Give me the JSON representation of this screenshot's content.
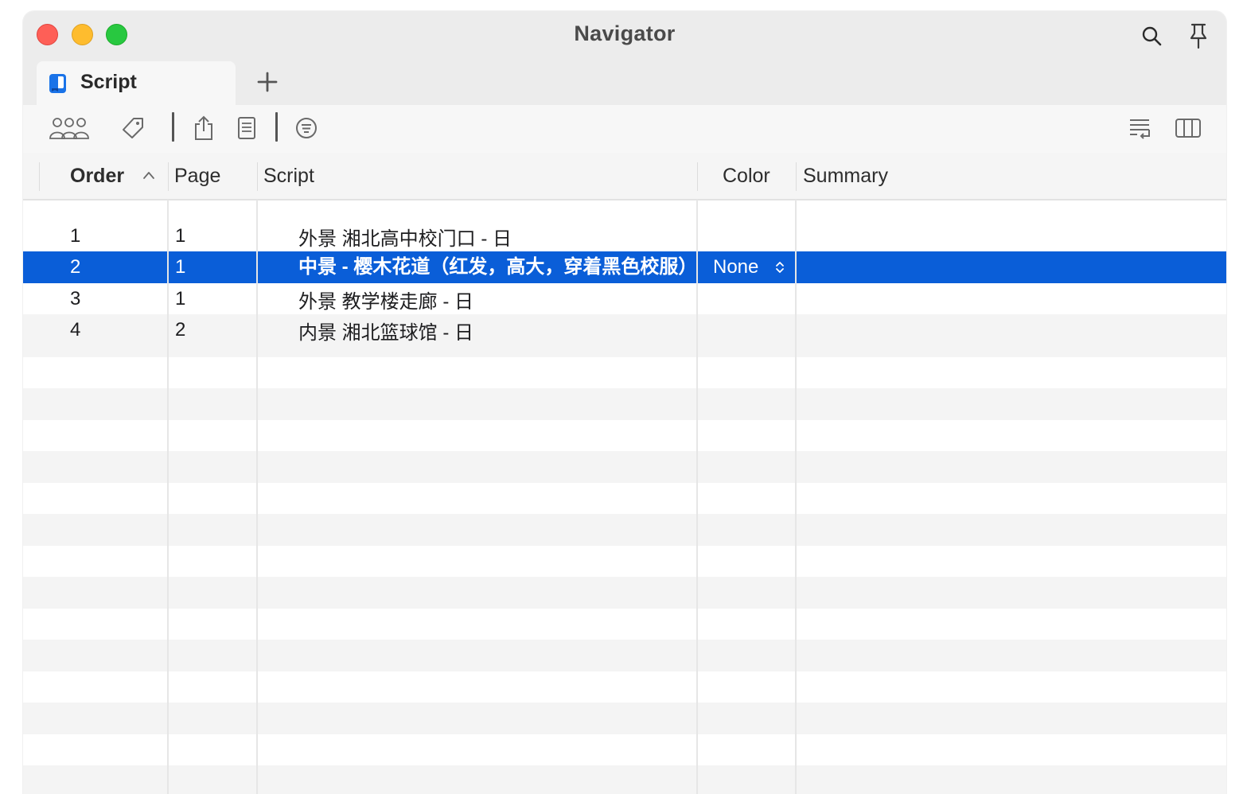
{
  "window": {
    "title": "Navigator"
  },
  "tabs": [
    {
      "label": "Script",
      "icon": "script-book-icon"
    }
  ],
  "toolbar": {
    "left_icons": [
      "characters-icon",
      "tag-icon",
      "share-icon",
      "notes-icon",
      "filter-icon"
    ],
    "right_icons": [
      "wrap-text-icon",
      "columns-icon"
    ]
  },
  "table": {
    "columns": [
      "Order",
      "Page",
      "Script",
      "Color",
      "Summary"
    ],
    "sort_column": "Order",
    "sort_direction": "ascending",
    "rows": [
      {
        "order": "1",
        "page": "1",
        "script": "外景  湘北高中校门口  -  日",
        "color": "",
        "summary": ""
      },
      {
        "order": "2",
        "page": "1",
        "script": "中景  -  樱木花道（红发，高大，穿着黑色校服）",
        "color": "None",
        "summary": ""
      },
      {
        "order": "3",
        "page": "1",
        "script": "外景  教学楼走廊  -  日",
        "color": "",
        "summary": ""
      },
      {
        "order": "4",
        "page": "2",
        "script": "内景  湘北篮球馆  -  日",
        "color": "",
        "summary": ""
      }
    ],
    "selected_row": 1
  },
  "colors": {
    "selection": "#0a5ed8",
    "close": "#fe5f57",
    "minimize": "#febc2e",
    "maximize": "#28c840"
  }
}
